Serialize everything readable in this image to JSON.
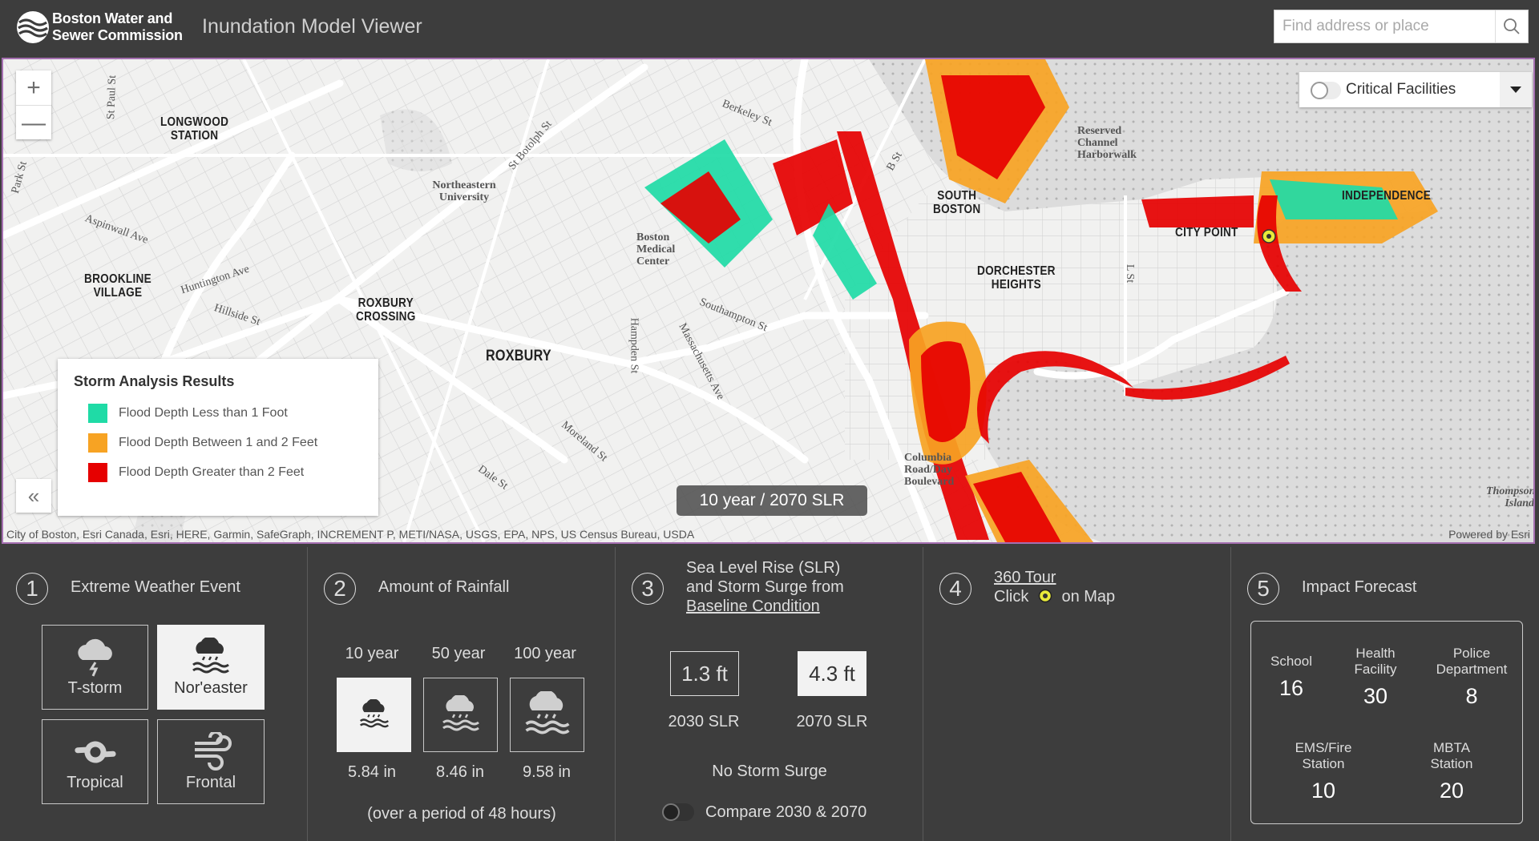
{
  "header": {
    "org_line1": "Boston Water and",
    "org_line2": "Sewer Commission",
    "app_title": "Inundation Model Viewer",
    "search_placeholder": "Find address or place",
    "logo_icon": "waves-circle-logo",
    "search_icon": "magnifier"
  },
  "map": {
    "zoom_in": "+",
    "zoom_out": "—",
    "critical_facilities_label": "Critical Facilities",
    "critical_facilities_on": false,
    "scenario_label": "10 year / 2070 SLR",
    "attribution": "City of Boston, Esri Canada, Esri, HERE, Garmin, SafeGraph, INCREMENT P, METI/NASA, USGS, EPA, NPS, US Census Bureau, USDA",
    "powered_by": "Powered by Esri",
    "collapse_icon": "«",
    "legend": {
      "title": "Storm Analysis Results",
      "items": [
        {
          "label": "Flood Depth Less than 1 Foot",
          "color": "#1fdba6"
        },
        {
          "label": "Flood Depth Between 1 and 2 Feet",
          "color": "#f7a323"
        },
        {
          "label": "Flood Depth Greater than 2 Feet",
          "color": "#e60000"
        }
      ]
    },
    "place_labels": [
      {
        "text": "LONGWOOD\nSTATION"
      },
      {
        "text": "BROOKLINE\nVILLAGE"
      },
      {
        "text": "ROXBURY\nCROSSING"
      },
      {
        "text": "ROXBURY"
      },
      {
        "text": "SOUTH\nBOSTON"
      },
      {
        "text": "DORCHESTER\nHEIGHTS"
      },
      {
        "text": "CITY POINT"
      },
      {
        "text": "INDEPENDENCE"
      }
    ],
    "street_labels": [
      "Northeastern University",
      "Aspinwall Ave",
      "Huntington Ave",
      "Hillside St",
      "St Botolph St",
      "Berkeley St",
      "Southampton St",
      "Massachusetts Ave",
      "Hampden St",
      "Moreland St",
      "Dale St",
      "Boston Medical Center",
      "Reserved Channel Harborwalk",
      "Columbia Road/Day Boulevard",
      "Thompson Island",
      "Park St",
      "St Paul St",
      "L St",
      "B St"
    ]
  },
  "panels": {
    "weather": {
      "number": "1",
      "title": "Extreme Weather Event",
      "options": [
        {
          "label": "T-storm",
          "icon": "thunderstorm-icon",
          "selected": false
        },
        {
          "label": "Nor'easter",
          "icon": "noreaster-icon",
          "selected": true
        },
        {
          "label": "Tropical",
          "icon": "hurricane-icon",
          "selected": false
        },
        {
          "label": "Frontal",
          "icon": "wind-icon",
          "selected": false
        }
      ]
    },
    "rainfall": {
      "number": "2",
      "title": "Amount of Rainfall",
      "options": [
        {
          "period": "10 year",
          "amount": "5.84 in",
          "selected": true
        },
        {
          "period": "50 year",
          "amount": "8.46 in",
          "selected": false
        },
        {
          "period": "100 year",
          "amount": "9.58 in",
          "selected": false
        }
      ],
      "note": "(over a period of 48 hours)"
    },
    "slr": {
      "number": "3",
      "title_line1": "Sea Level Rise (SLR)",
      "title_line2": "and Storm Surge from",
      "title_link": "Baseline Condition",
      "options": [
        {
          "value": "1.3 ft",
          "label": "2030 SLR",
          "selected": false
        },
        {
          "value": "4.3 ft",
          "label": "2070 SLR",
          "selected": true
        }
      ],
      "surge": "No Storm Surge",
      "compare_label": "Compare 2030 & 2070",
      "compare_on": false
    },
    "tour": {
      "number": "4",
      "link": "360 Tour",
      "click_pre": "Click",
      "click_post": "on Map"
    },
    "impact": {
      "number": "5",
      "title": "Impact Forecast",
      "stats": [
        {
          "label": "School",
          "value": "16"
        },
        {
          "label": "Health\nFacility",
          "value": "30"
        },
        {
          "label": "Police\nDepartment",
          "value": "8"
        },
        {
          "label": "EMS/Fire\nStation",
          "value": "10"
        },
        {
          "label": "MBTA\nStation",
          "value": "20"
        }
      ]
    }
  }
}
